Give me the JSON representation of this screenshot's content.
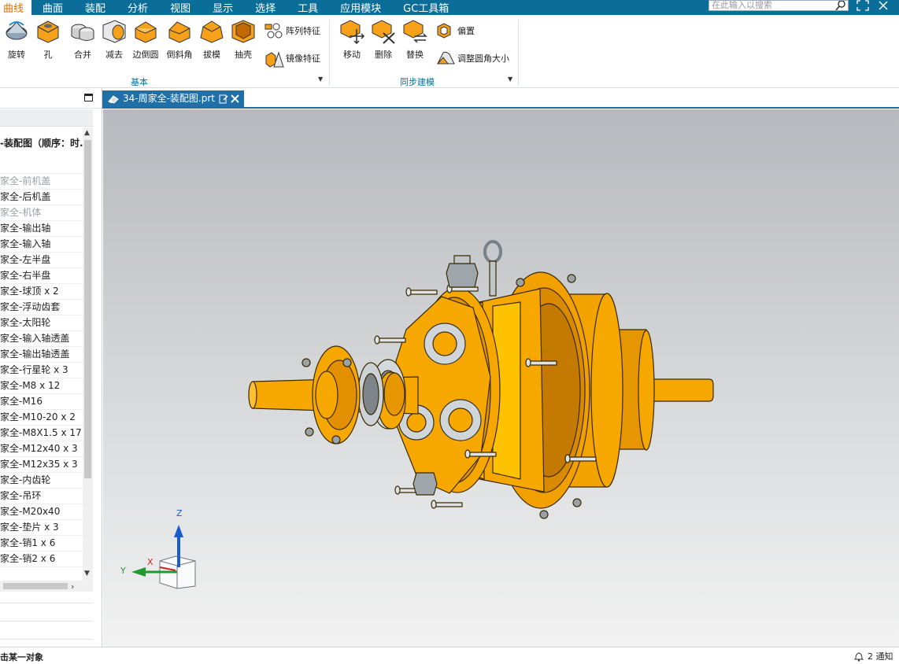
{
  "menu": {
    "tabs": [
      {
        "label": "曲线",
        "active": true
      },
      {
        "label": "曲面"
      },
      {
        "label": "装配"
      },
      {
        "label": "分析"
      },
      {
        "label": "视图"
      },
      {
        "label": "显示"
      },
      {
        "label": "选择"
      },
      {
        "label": "工具"
      },
      {
        "label": "应用模块"
      },
      {
        "label": "GC工具箱"
      }
    ],
    "search_placeholder": "在此输入以搜索"
  },
  "ribbon": {
    "basic_group": {
      "label": "基本",
      "tools": {
        "revolve": "旋转",
        "hole": "孔",
        "unite": "合并",
        "subtract": "减去",
        "edge_blend": "边倒圆",
        "chamfer": "倒斜角",
        "draft": "拔模",
        "shell": "抽壳",
        "pattern_feature": "阵列特征",
        "mirror_feature": "镜像特征"
      }
    },
    "sync_group": {
      "label": "同步建模",
      "tools": {
        "move": "移动",
        "delete": "删除",
        "replace": "替换",
        "offset": "偏置",
        "resize_blend": "调整圆角大小"
      }
    }
  },
  "navigator": {
    "root": "-装配图（顺序：时...",
    "items": [
      {
        "label": "家全-前机盖",
        "dim": true
      },
      {
        "label": "家全-后机盖"
      },
      {
        "label": "家全-机体",
        "dim": true
      },
      {
        "label": "家全-输出轴"
      },
      {
        "label": "家全-输入轴"
      },
      {
        "label": "家全-左半盘"
      },
      {
        "label": "家全-右半盘"
      },
      {
        "label": "家全-球顶 x 2"
      },
      {
        "label": "家全-浮动齿套"
      },
      {
        "label": "家全-太阳轮"
      },
      {
        "label": "家全-输入轴透盖"
      },
      {
        "label": "家全-输出轴透盖"
      },
      {
        "label": "家全-行星轮 x 3"
      },
      {
        "label": "家全-M8 x 12"
      },
      {
        "label": "家全-M16"
      },
      {
        "label": "家全-M10-20 x 2"
      },
      {
        "label": "家全-M8X1.5 x 17"
      },
      {
        "label": "家全-M12x40 x 3"
      },
      {
        "label": "家全-M12x35 x 3"
      },
      {
        "label": "家全-内齿轮"
      },
      {
        "label": "家全-吊环"
      },
      {
        "label": "家全-M20x40"
      },
      {
        "label": "家全-垫片 x 3"
      },
      {
        "label": "家全-销1 x 6"
      },
      {
        "label": "家全-销2 x 6"
      }
    ]
  },
  "document_tab": {
    "title": "34-周家全-装配图.prt"
  },
  "triad": {
    "x": "X",
    "y": "Y",
    "z": "Z"
  },
  "colors": {
    "accent": "#0b6e99",
    "tab": "#1f6fa8",
    "model": "#f6a800"
  },
  "status": {
    "prompt": "击某一对象",
    "notifications": "2 通知"
  }
}
